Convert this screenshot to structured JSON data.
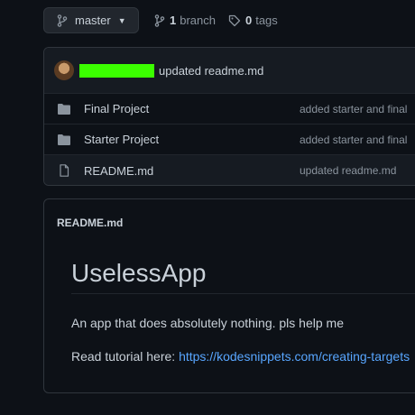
{
  "toolbar": {
    "branch_name": "master",
    "branch_count": "1",
    "branch_label": "branch",
    "tag_count": "0",
    "tag_label": "tags"
  },
  "commit": {
    "author_redacted": true,
    "message": "updated readme.md"
  },
  "files": [
    {
      "type": "folder",
      "name": "Final Project",
      "commit": "added starter and final"
    },
    {
      "type": "folder",
      "name": "Starter Project",
      "commit": "added starter and final"
    },
    {
      "type": "file",
      "name": "README.md",
      "commit": "updated readme.md"
    }
  ],
  "readme": {
    "header": "README.md",
    "title": "UselessApp",
    "paragraph": "An app that does absolutely nothing. pls help me",
    "tutorial_prefix": "Read tutorial here: ",
    "tutorial_link": "https://kodesnippets.com/creating-targets"
  },
  "colors": {
    "background": "#0d1117",
    "link": "#58a6ff",
    "redaction": "#3bff00"
  }
}
